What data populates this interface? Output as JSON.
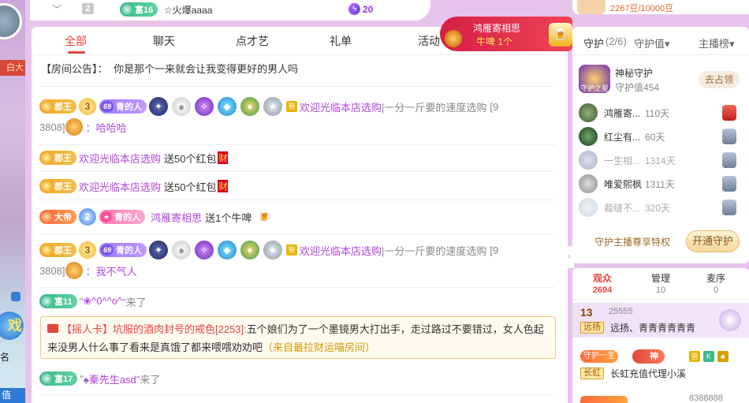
{
  "left_strip": {
    "tag_text": "白大",
    "badge_glyph": "戏",
    "ming": "名",
    "zhi": "值"
  },
  "top_strip": {
    "rank": "2",
    "fu_badge": "富16",
    "username": "☆火爆aaaa",
    "score": "20"
  },
  "tabs": [
    {
      "label": "全部",
      "active": true
    },
    {
      "label": "聊天",
      "active": false
    },
    {
      "label": "点才艺",
      "active": false
    },
    {
      "label": "礼单",
      "active": false
    },
    {
      "label": "活动",
      "active": false
    }
  ],
  "notice": {
    "prefix": "【房间公告】：",
    "text": "你是那个一来就会让我变得更好的男人吗"
  },
  "messages": [
    {
      "kind": "chat",
      "badge": "郡王",
      "level": "3",
      "fans_level": "69",
      "fans_name": "青的人",
      "guan": "管",
      "nick": "欢迎光临本店选购",
      "suffix": "|一分一斤要的速度选购",
      "id_line1": "[9",
      "id_line2": "3808]",
      "colon": "：",
      "text": "哈哈哈"
    },
    {
      "kind": "gift",
      "badge": "郡王",
      "nick": "欢迎光临本店选购",
      "action": "送50个红包",
      "cai": "财"
    },
    {
      "kind": "gift",
      "badge": "郡王",
      "nick": "欢迎光临本店选购",
      "action": "送50个红包",
      "cai": "财"
    },
    {
      "kind": "gift2",
      "badge": "大帝",
      "level": "2",
      "fans_name": "青的人",
      "nick": "鸿雁寄相思",
      "action": "送1个牛啤"
    },
    {
      "kind": "chat",
      "badge": "郡王",
      "level": "3",
      "fans_level": "69",
      "fans_name": "青的人",
      "guan": "管",
      "nick": "欢迎光临本店选购",
      "suffix": "|一分一斤要的速度选购",
      "id_line1": "[9",
      "id_line2": "3808]",
      "colon": "：",
      "text": "我不气人"
    }
  ],
  "enter1": {
    "badge": "富11",
    "text_a": "\"",
    "nick": "❀^0^^o^",
    "text_b": "\"来了"
  },
  "broadcast": {
    "pre": "【摇人卡】坑服的酒肉封号的戒色[2253]:",
    "text": "五个娘们为了一个墨镜男大打出手，走过路过不要错过，女人色起来没男人什么事了看来是真饿了都来喂喂劝劝吧",
    "from": "（来自最拉财运喵房间）"
  },
  "enter2": {
    "badge": "富17",
    "text_a": "\"",
    "nick": "♠秦先生asd",
    "text_b": "\"来了"
  },
  "pill": {
    "title": "鸿雁寄相思",
    "gift": "牛啤",
    "count": "1个"
  },
  "coin_box": {
    "text": "2267豆/10000豆"
  },
  "guard": {
    "tab_guard": "守护",
    "tab_guard_count": "(2/6)",
    "tab_value": "守护值▾",
    "tab_rank": "主播榜▾",
    "mystery": {
      "name": "神秘守护",
      "value": "守护值454",
      "btn": "去占领",
      "crown_label": "守护之星"
    },
    "items": [
      {
        "name": "鸿雁寄...",
        "days": "110天",
        "dim": false,
        "red": true
      },
      {
        "name": "红尘有...",
        "days": "60天",
        "dim": false,
        "red": false
      },
      {
        "name": "一生相...",
        "days": "1314天",
        "dim": true,
        "red": false
      },
      {
        "name": "唯爱熙枫",
        "days": "1311天",
        "dim": false,
        "red": false
      },
      {
        "name": "裁缝不...",
        "days": "320天",
        "dim": true,
        "red": false
      }
    ],
    "privilege": "守护主播尊享特权",
    "open_btn": "开通守护"
  },
  "audience": {
    "tabs": [
      {
        "label": "观众",
        "count": "2694",
        "active": true
      },
      {
        "label": "管理",
        "count": "10",
        "active": false
      },
      {
        "label": "麦序",
        "count": "0",
        "active": false
      }
    ],
    "row1": {
      "level": "13",
      "id": "25555",
      "tag": "远扬",
      "name": "远扬、青青青青青青"
    },
    "row2": {
      "shou": "守护一生",
      "god": "神",
      "sq1": "管",
      "sq2": "K",
      "sq3": "♣",
      "tag": "长虹",
      "name": "长虹充值代理小溪"
    },
    "row3": {
      "id": "8388888"
    }
  }
}
